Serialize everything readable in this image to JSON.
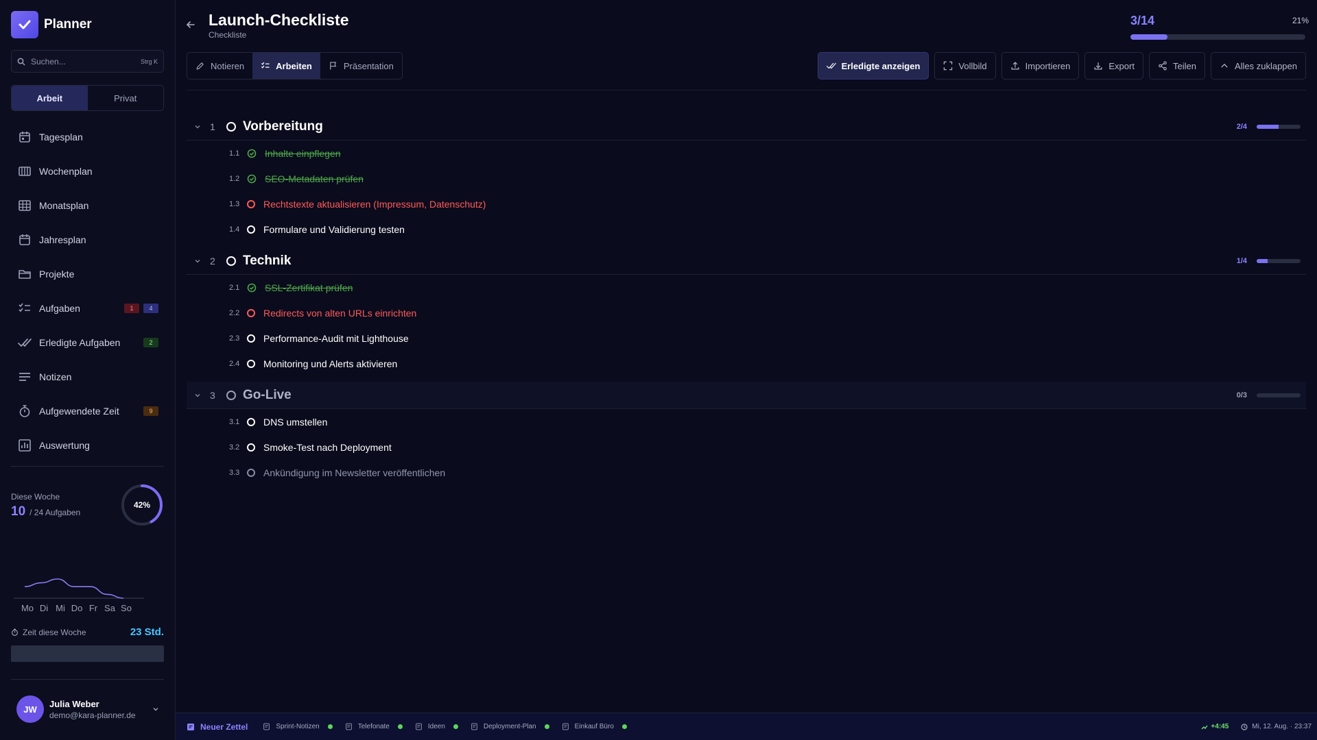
{
  "app": {
    "name": "Planner"
  },
  "search": {
    "placeholder": "Suchen...",
    "shortcut": "Strg K"
  },
  "workspace": {
    "tabs": [
      "Arbeit",
      "Privat"
    ],
    "active": "Arbeit"
  },
  "nav": [
    {
      "label": "Tagesplan",
      "icon": "calendar-day-icon"
    },
    {
      "label": "Wochenplan",
      "icon": "calendar-week-icon"
    },
    {
      "label": "Monatsplan",
      "icon": "calendar-grid-icon"
    },
    {
      "label": "Jahresplan",
      "icon": "calendar-year-icon"
    },
    {
      "label": "Projekte",
      "icon": "folder-icon"
    },
    {
      "label": "Aufgaben",
      "icon": "task-list-icon",
      "badges": [
        {
          "value": "1",
          "color": "red"
        },
        {
          "value": "4",
          "color": "blue"
        }
      ]
    },
    {
      "label": "Erledigte Aufgaben",
      "icon": "double-check-icon",
      "badges": [
        {
          "value": "2",
          "color": "green"
        }
      ]
    },
    {
      "label": "Notizen",
      "icon": "notes-lines-icon"
    },
    {
      "label": "Aufgewendete Zeit",
      "icon": "stopwatch-icon",
      "badges": [
        {
          "value": "9",
          "color": "orange"
        }
      ]
    },
    {
      "label": "Auswertung",
      "icon": "chart-icon"
    }
  ],
  "week": {
    "label": "Diese Woche",
    "done": "10",
    "total_text": "/ 24 Aufgaben",
    "percent_text": "42%",
    "percent": 0.42,
    "days": [
      "Mo",
      "Di",
      "Mi",
      "Do",
      "Fr",
      "Sa",
      "So"
    ],
    "activity": [
      3,
      4,
      5,
      3,
      3,
      1,
      0
    ],
    "time_label": "Zeit diese Woche",
    "time_value": "23 Std."
  },
  "user": {
    "initials": "JW",
    "name": "Julia Weber",
    "email": "demo@kara-planner.de"
  },
  "page": {
    "title": "Launch-Checkliste",
    "subtitle": "Checkliste",
    "progress_count": "3/14",
    "progress_percent_text": "21%",
    "progress": 0.21
  },
  "view_tabs": [
    {
      "label": "Notieren",
      "icon": "pencil-icon"
    },
    {
      "label": "Arbeiten",
      "icon": "checklist-icon",
      "active": true
    },
    {
      "label": "Präsentation",
      "icon": "flag-icon"
    }
  ],
  "actions": [
    {
      "label": "Erledigte anzeigen",
      "icon": "double-check-icon",
      "primary": true
    },
    {
      "label": "Vollbild",
      "icon": "fullscreen-icon"
    },
    {
      "label": "Importieren",
      "icon": "upload-icon"
    },
    {
      "label": "Export",
      "icon": "download-icon"
    },
    {
      "label": "Teilen",
      "icon": "share-icon"
    },
    {
      "label": "Alles zuklappen",
      "icon": "chevron-up-icon"
    }
  ],
  "groups": [
    {
      "num": "1",
      "title": "Vorbereitung",
      "count": "2/4",
      "progress": 0.5,
      "items": [
        {
          "num": "1.1",
          "text": "Inhalte einpflegen",
          "state": "done"
        },
        {
          "num": "1.2",
          "text": "SEO-Metadaten prüfen",
          "state": "done"
        },
        {
          "num": "1.3",
          "text": "Rechtstexte aktualisieren (Impressum, Datenschutz)",
          "state": "urgent"
        },
        {
          "num": "1.4",
          "text": "Formulare und Validierung testen",
          "state": "normal"
        }
      ]
    },
    {
      "num": "2",
      "title": "Technik",
      "count": "1/4",
      "progress": 0.25,
      "items": [
        {
          "num": "2.1",
          "text": "SSL-Zertifikat prüfen",
          "state": "done"
        },
        {
          "num": "2.2",
          "text": "Redirects von alten URLs einrichten",
          "state": "urgent"
        },
        {
          "num": "2.3",
          "text": "Performance-Audit mit Lighthouse",
          "state": "normal"
        },
        {
          "num": "2.4",
          "text": "Monitoring und Alerts aktivieren",
          "state": "normal"
        }
      ]
    },
    {
      "num": "3",
      "title": "Go-Live",
      "count": "0/3",
      "progress": 0,
      "highlight": true,
      "items": [
        {
          "num": "3.1",
          "text": "DNS umstellen",
          "state": "normal"
        },
        {
          "num": "3.2",
          "text": "Smoke-Test nach Deployment",
          "state": "normal"
        },
        {
          "num": "3.3",
          "text": "Ankündigung im Newsletter veröffentlichen",
          "state": "muted"
        }
      ]
    }
  ],
  "bottom_bar": {
    "new_note": "Neuer Zettel",
    "notes": [
      "Sprint-Notizen",
      "Telefonate",
      "Ideen",
      "Deployment-Plan",
      "Einkauf Büro"
    ],
    "delta": "+4:45",
    "datetime": "Mi, 12. Aug. · 23:37"
  },
  "colors": {
    "accent": "#7a72f0",
    "done": "#4ea84a",
    "urgent": "#ff5a5a",
    "time": "#47c6ff"
  }
}
